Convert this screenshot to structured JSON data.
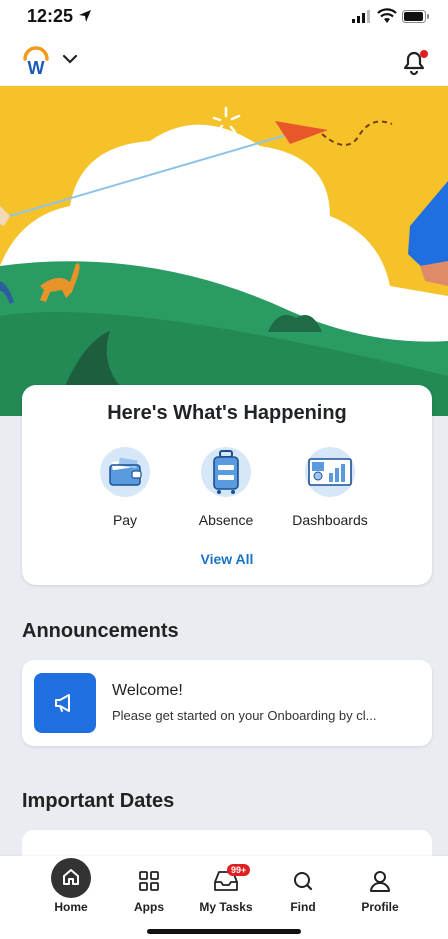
{
  "status_bar": {
    "time": "12:25"
  },
  "header": {
    "logo_letter": "W",
    "notification_dot_color": "#e02020"
  },
  "happening": {
    "title": "Here's What's Happening",
    "items": [
      {
        "label": "Pay",
        "icon": "wallet-icon"
      },
      {
        "label": "Absence",
        "icon": "luggage-icon"
      },
      {
        "label": "Dashboards",
        "icon": "dashboard-icon"
      }
    ],
    "view_all": "View All"
  },
  "announcements": {
    "title": "Announcements",
    "items": [
      {
        "heading": "Welcome!",
        "body": "Please get started on your Onboarding by cl..."
      }
    ]
  },
  "important_dates": {
    "title": "Important Dates"
  },
  "bottom_nav": {
    "items": [
      {
        "label": "Home",
        "icon": "home-icon",
        "active": true
      },
      {
        "label": "Apps",
        "icon": "apps-grid-icon"
      },
      {
        "label": "My Tasks",
        "icon": "inbox-icon",
        "badge": "99+"
      },
      {
        "label": "Find",
        "icon": "search-icon"
      },
      {
        "label": "Profile",
        "icon": "person-icon"
      }
    ]
  },
  "colors": {
    "accent_blue": "#1a73c8",
    "hero_yellow": "#f6c22a",
    "hero_green": "#2a9b63"
  }
}
